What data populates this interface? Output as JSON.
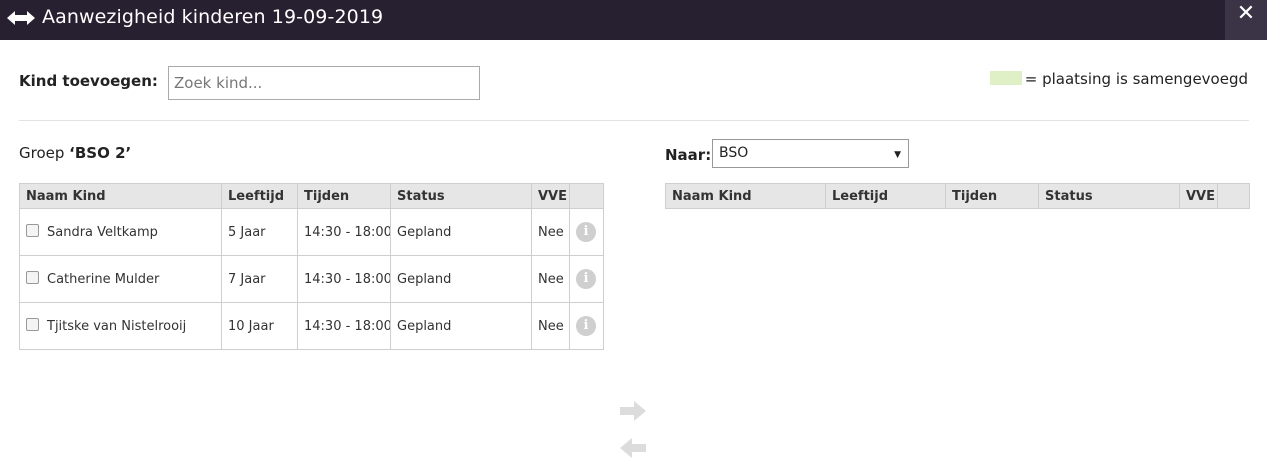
{
  "window": {
    "title": "Aanwezigheid kinderen 19-09-2019",
    "close_symbol": "✕",
    "title_icon": "left-right-arrows-icon"
  },
  "add_child": {
    "label": "Kind toevoegen:",
    "placeholder": "Zoek kind..."
  },
  "legend": {
    "text": "= plaatsing is samengevoegd",
    "color": "#dff0c6"
  },
  "group": {
    "prefix": "Groep ",
    "name": "‘BSO 2’"
  },
  "destination": {
    "label": "Naar:",
    "selected": "BSO"
  },
  "source_table": {
    "columns": [
      "Naam Kind",
      "Leeftijd",
      "Tijden",
      "Status",
      "VVE",
      ""
    ],
    "rows": [
      {
        "name": "Sandra Veltkamp",
        "age": "5 Jaar",
        "times": "14:30 - 18:00",
        "status": "Gepland",
        "vve": "Nee"
      },
      {
        "name": "Catherine Mulder",
        "age": "7 Jaar",
        "times": "14:30 - 18:00",
        "status": "Gepland",
        "vve": "Nee"
      },
      {
        "name": "Tjitske van Nistelrooij",
        "age": "10 Jaar",
        "times": "14:30 - 18:00",
        "status": "Gepland",
        "vve": "Nee"
      }
    ]
  },
  "target_table": {
    "columns": [
      "Naam Kind",
      "Leeftijd",
      "Tijden",
      "Status",
      "VVE",
      ""
    ]
  },
  "icons": {
    "info": "info-icon",
    "move_right": "arrow-right-icon",
    "move_left": "arrow-left-icon"
  }
}
